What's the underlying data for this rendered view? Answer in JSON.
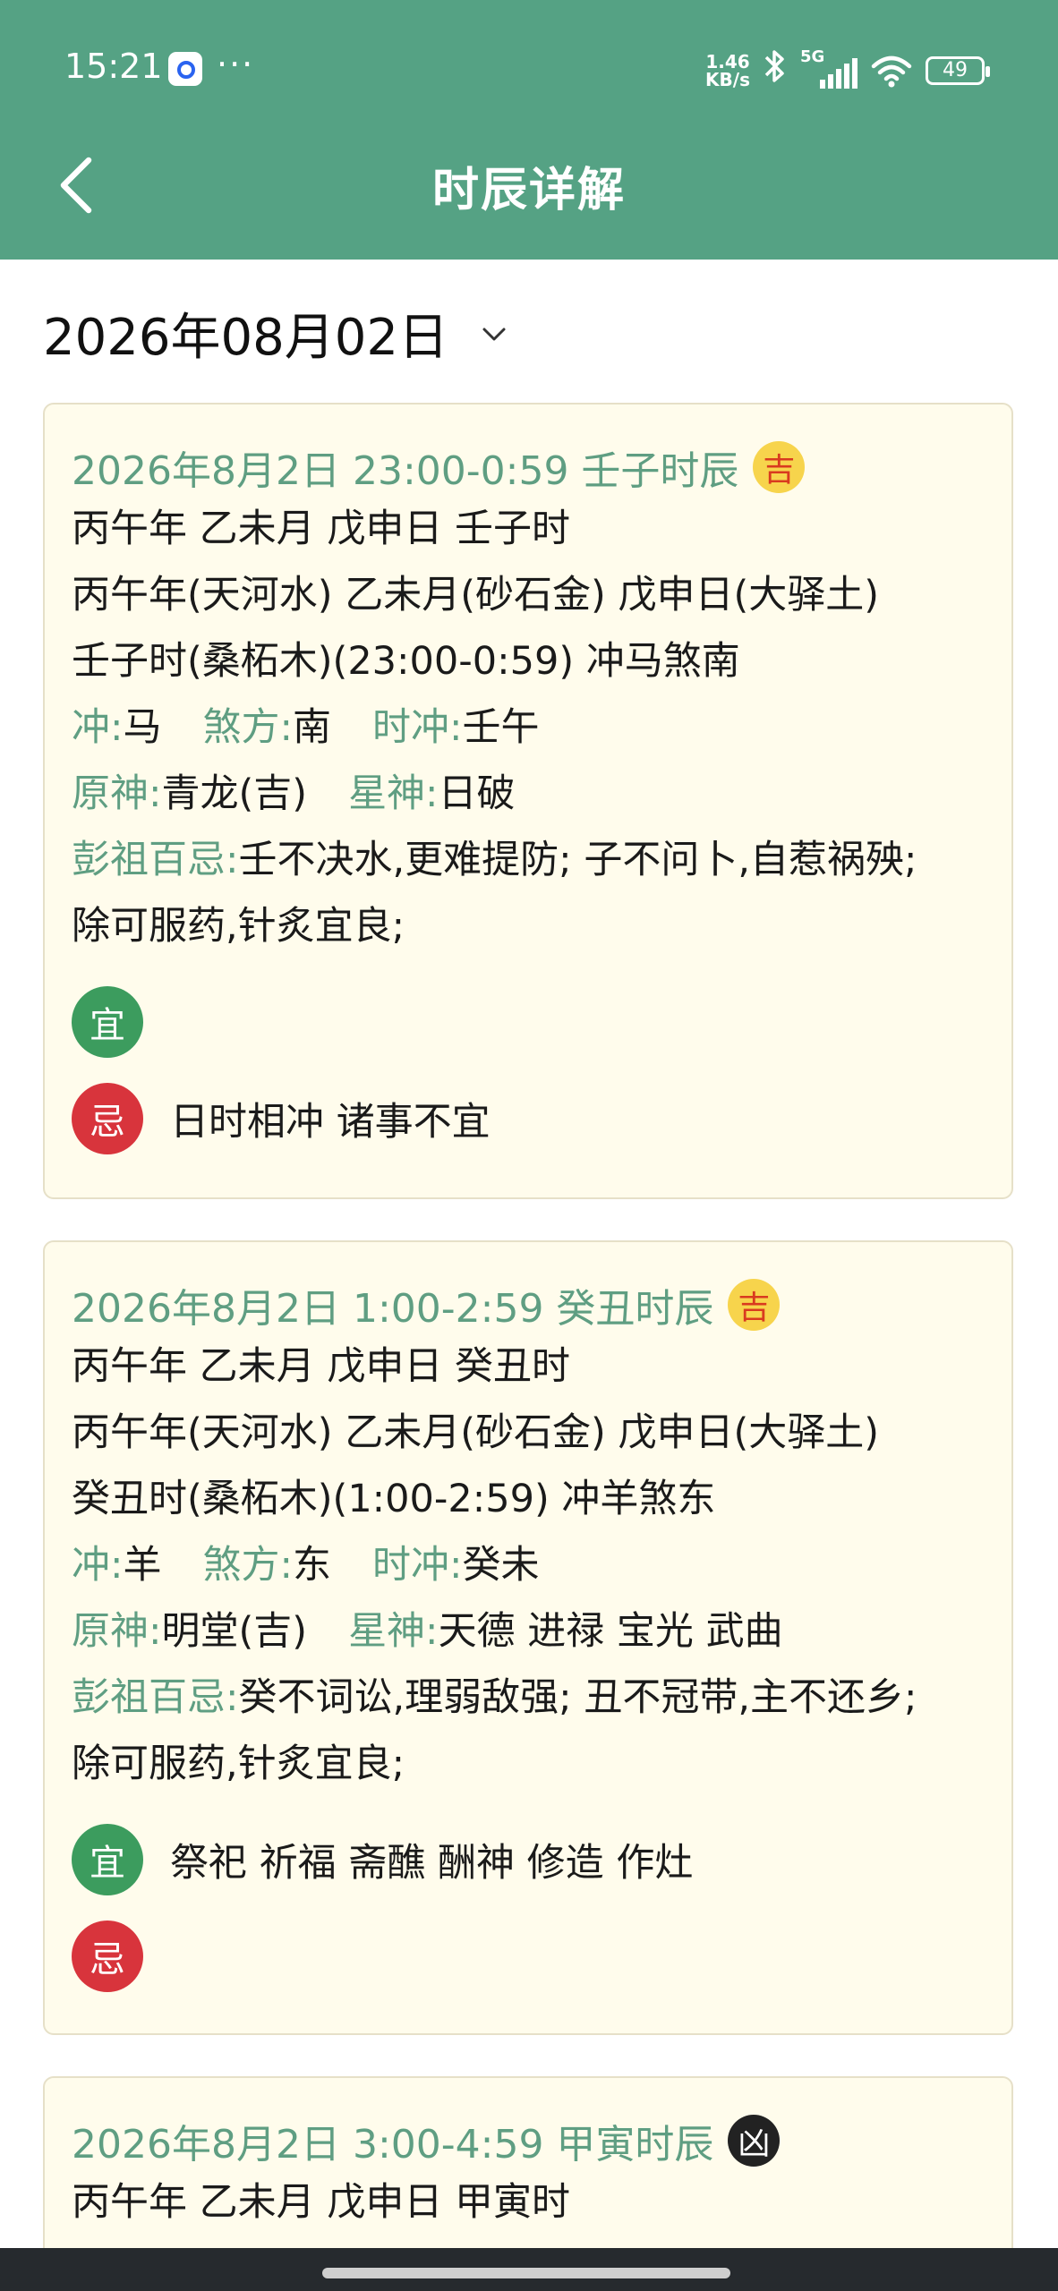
{
  "status_bar": {
    "time": "15:21",
    "dots": "···",
    "net_speed_value": "1.46",
    "net_speed_unit": "KB/s",
    "network": "5G",
    "battery": "49"
  },
  "header": {
    "title": "时辰详解"
  },
  "date_picker": {
    "value": "2026年08月02日"
  },
  "cards": [
    {
      "title": "2026年8月2日 23:00-0:59 壬子时辰",
      "badge": "吉",
      "ganzhi": "丙午年 乙未月 戊申日 壬子时",
      "nayin": "丙午年(天河水) 乙未月(砂石金) 戊申日(大驿土)",
      "shichen": "壬子时(桑柘木)(23:00-0:59) 冲马煞南",
      "chong_label": "冲:",
      "chong": "马",
      "sha_label": "煞方:",
      "sha": "南",
      "shichong_label": "时冲:",
      "shichong": "壬午",
      "yuanshen_label": "原神:",
      "yuanshen": "青龙(吉)",
      "xingshen_label": "星神:",
      "xingshen": "日破",
      "pengzu_label": "彭祖百忌:",
      "pengzu": "壬不决水,更难提防; 子不问卜,自惹祸殃;",
      "pengzu2": "除可服药,针炙宜良;",
      "yi_label": "宜",
      "yi": "",
      "ji_label": "忌",
      "ji": "日时相冲 诸事不宜"
    },
    {
      "title": "2026年8月2日 1:00-2:59 癸丑时辰",
      "badge": "吉",
      "ganzhi": "丙午年 乙未月 戊申日 癸丑时",
      "nayin": "丙午年(天河水) 乙未月(砂石金) 戊申日(大驿土)",
      "shichen": "癸丑时(桑柘木)(1:00-2:59) 冲羊煞东",
      "chong_label": "冲:",
      "chong": "羊",
      "sha_label": "煞方:",
      "sha": "东",
      "shichong_label": "时冲:",
      "shichong": "癸未",
      "yuanshen_label": "原神:",
      "yuanshen": "明堂(吉)",
      "xingshen_label": "星神:",
      "xingshen": "天德 进禄 宝光 武曲",
      "pengzu_label": "彭祖百忌:",
      "pengzu": "癸不词讼,理弱敌强; 丑不冠带,主不还乡;",
      "pengzu2": "除可服药,针炙宜良;",
      "yi_label": "宜",
      "yi": "祭祀 祈福 斋醮 酬神 修造 作灶",
      "ji_label": "忌",
      "ji": ""
    },
    {
      "title": "2026年8月2日 3:00-4:59 甲寅时辰",
      "badge": "凶",
      "ganzhi": "丙午年 乙未月 戊申日 甲寅时"
    }
  ]
}
